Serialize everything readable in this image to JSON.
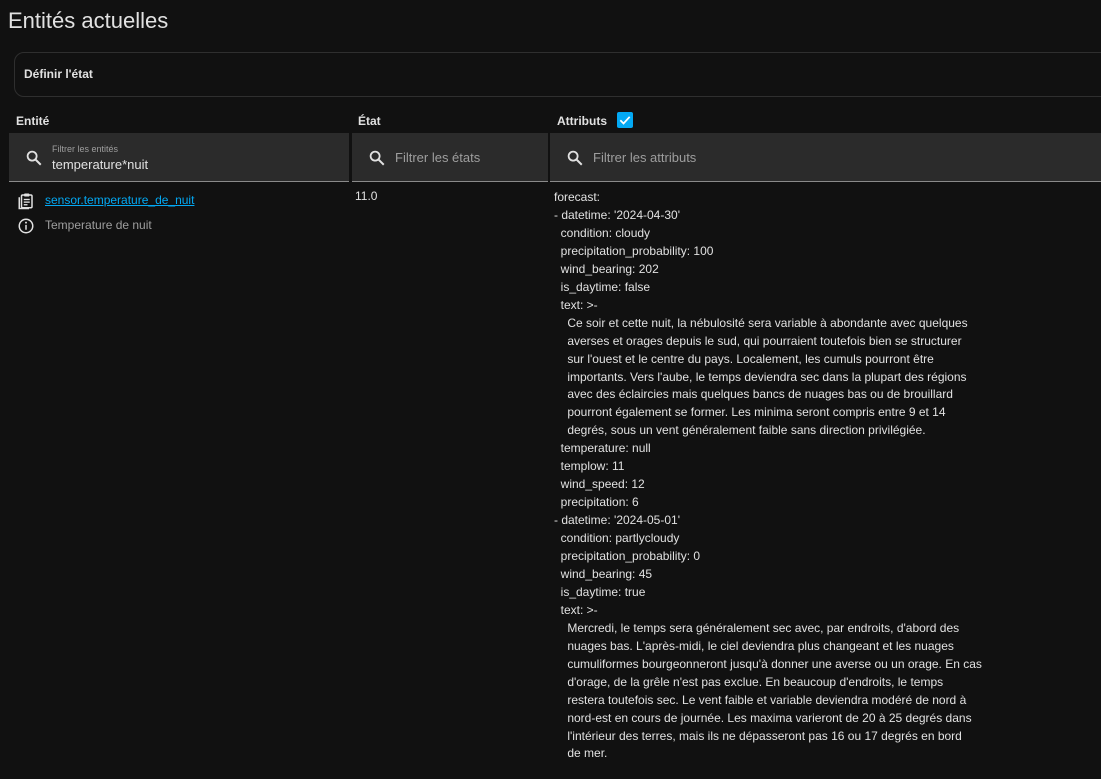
{
  "page": {
    "title": "Entités actuelles",
    "set_state_label": "Définir l'état"
  },
  "columns": {
    "entity": "Entité",
    "state": "État",
    "attributes": "Attributs",
    "attributes_checked": true
  },
  "filters": {
    "entity": {
      "label": "Filtrer les entités",
      "value": "temperature*nuit"
    },
    "state": {
      "placeholder": "Filtrer les états"
    },
    "attributes": {
      "placeholder": "Filtrer les attributs"
    }
  },
  "icons": {
    "filter_search": "search-icon",
    "entity_action": "clipboard-list-icon",
    "entity_info": "info-circle-icon",
    "checkbox": "checkmark-icon"
  },
  "colors": {
    "accent": "#03a9f4",
    "background": "#111111",
    "input_background": "#2b2b2b"
  },
  "entity_row": {
    "entity_id": "sensor.temperature_de_nuit",
    "friendly_name": "Temperature de nuit",
    "state": "11.0",
    "attributes_lines": [
      "forecast:",
      "- datetime: '2024-04-30'",
      "  condition: cloudy",
      "  precipitation_probability: 100",
      "  wind_bearing: 202",
      "  is_daytime: false",
      "  text: >-",
      "    Ce soir et cette nuit, la nébulosité sera variable à abondante avec quelques",
      "    averses et orages depuis le sud, qui pourraient toutefois bien se structurer",
      "    sur l'ouest et le centre du pays. Localement, les cumuls pourront être",
      "    importants. Vers l'aube, le temps deviendra sec dans la plupart des régions",
      "    avec des éclaircies mais quelques bancs de nuages bas ou de brouillard",
      "    pourront également se former. Les minima seront compris entre 9 et 14",
      "    degrés, sous un vent généralement faible sans direction privilégiée.",
      "  temperature: null",
      "  templow: 11",
      "  wind_speed: 12",
      "  precipitation: 6",
      "- datetime: '2024-05-01'",
      "  condition: partlycloudy",
      "  precipitation_probability: 0",
      "  wind_bearing: 45",
      "  is_daytime: true",
      "  text: >-",
      "    Mercredi, le temps sera généralement sec avec, par endroits, d'abord des",
      "    nuages bas. L'après-midi, le ciel deviendra plus changeant et les nuages",
      "    cumuliformes bourgeonneront jusqu'à donner une averse ou un orage. En cas",
      "    d'orage, de la grêle n'est pas exclue. En beaucoup d'endroits, le temps",
      "    restera toutefois sec. Le vent faible et variable deviendra modéré de nord à",
      "    nord-est en cours de journée. Les maxima varieront de 20 à 25 degrés dans",
      "    l'intérieur des terres, mais ils ne dépasseront pas 16 ou 17 degrés en bord",
      "    de mer."
    ]
  }
}
